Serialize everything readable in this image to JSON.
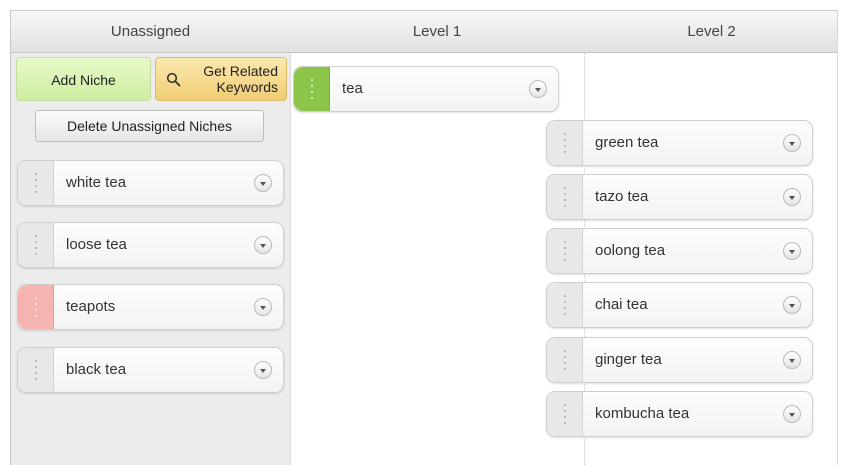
{
  "columns": {
    "unassigned": "Unassigned",
    "level1": "Level 1",
    "level2": "Level 2"
  },
  "toolbar": {
    "add_niche": "Add Niche",
    "get_related": "Get Related Keywords",
    "delete_unassigned": "Delete Unassigned Niches"
  },
  "unassigned_items": [
    {
      "label": "white tea",
      "grip": "gray"
    },
    {
      "label": "loose tea",
      "grip": "gray"
    },
    {
      "label": "teapots",
      "grip": "pink"
    },
    {
      "label": "black tea",
      "grip": "gray"
    }
  ],
  "level1_items": [
    {
      "label": "tea",
      "grip": "green"
    }
  ],
  "level2_items": [
    {
      "label": "green tea"
    },
    {
      "label": "tazo tea"
    },
    {
      "label": "oolong tea"
    },
    {
      "label": "chai tea"
    },
    {
      "label": "ginger tea"
    },
    {
      "label": "kombucha tea"
    }
  ],
  "icons": {
    "related": "magnifier-icon",
    "card_menu": "chevron-down-icon",
    "card_handle": "drag-handle-icon"
  },
  "colors": {
    "add_button": "#cdeea0",
    "related_button": "#f0cd73",
    "selected_grip": "#8cc54a",
    "warning_grip": "#f6b4b1"
  }
}
